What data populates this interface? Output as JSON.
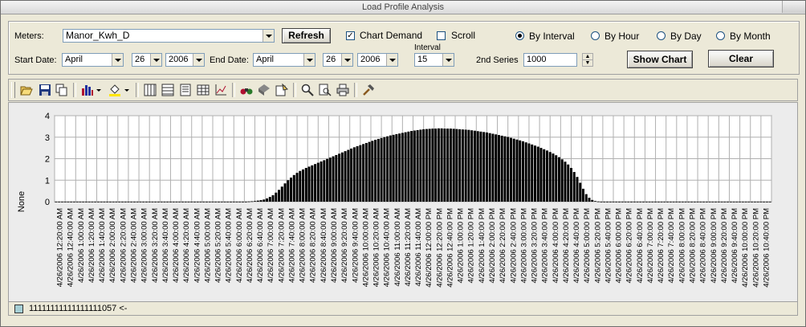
{
  "window": {
    "title": "Load Profile Analysis"
  },
  "controls": {
    "meters_label": "Meters:",
    "meter_value": "Manor_Kwh_D",
    "refresh_label": "Refresh",
    "chart_demand_label": "Chart Demand",
    "chart_demand_checked": true,
    "scroll_label": "Scroll",
    "scroll_checked": false,
    "radios": [
      {
        "label": "By Interval",
        "selected": true
      },
      {
        "label": "By Hour",
        "selected": false
      },
      {
        "label": "By Day",
        "selected": false
      },
      {
        "label": "By Month",
        "selected": false
      }
    ],
    "start_date_label": "Start Date:",
    "start_month": "April",
    "start_day": "26",
    "start_year": "2006",
    "end_date_label": "End Date:",
    "end_month": "April",
    "end_day": "26",
    "end_year": "2006",
    "interval_label": "Interval",
    "interval_value": "15",
    "second_series_label": "2nd Series",
    "second_series_value": "1000",
    "show_chart_label": "Show Chart",
    "clear_label": "Clear"
  },
  "toolbar": {
    "icons": [
      "open-folder-icon",
      "save-icon",
      "copy-icon",
      "bar-chart-icon",
      "chart-type-dropdown-icon",
      "fill-color-icon",
      "fill-color-dropdown-icon",
      "vertical-grid-icon",
      "horizontal-grid-icon",
      "legend-icon",
      "data-table-icon",
      "axis-icon",
      "binoculars-icon",
      "3d-icon",
      "palette-icon",
      "zoom-icon",
      "print-preview-icon",
      "print-icon",
      "tools-icon"
    ]
  },
  "chart_data": {
    "type": "bar",
    "ylabel": "None",
    "ylim": [
      0,
      4
    ],
    "yticks": [
      0,
      1,
      2,
      3,
      4
    ],
    "bar_color": "#000000",
    "x_labels": [
      "4/26/2006 12:20:00 AM",
      "4/26/2006 12:40:00 AM",
      "4/26/2006 1:00:00 AM",
      "4/26/2006 1:20:00 AM",
      "4/26/2006 1:40:00 AM",
      "4/26/2006 2:00:00 AM",
      "4/26/2006 2:20:00 AM",
      "4/26/2006 2:40:00 AM",
      "4/26/2006 3:00:00 AM",
      "4/26/2006 3:20:00 AM",
      "4/26/2006 3:40:00 AM",
      "4/26/2006 4:00:00 AM",
      "4/26/2006 4:20:00 AM",
      "4/26/2006 4:40:00 AM",
      "4/26/2006 5:00:00 AM",
      "4/26/2006 5:20:00 AM",
      "4/26/2006 5:40:00 AM",
      "4/26/2006 6:00:00 AM",
      "4/26/2006 6:20:00 AM",
      "4/26/2006 6:40:00 AM",
      "4/26/2006 7:00:00 AM",
      "4/26/2006 7:20:00 AM",
      "4/26/2006 7:40:00 AM",
      "4/26/2006 8:00:00 AM",
      "4/26/2006 8:20:00 AM",
      "4/26/2006 8:40:00 AM",
      "4/26/2006 9:00:00 AM",
      "4/26/2006 9:20:00 AM",
      "4/26/2006 9:40:00 AM",
      "4/26/2006 10:00:00 AM",
      "4/26/2006 10:20:00 AM",
      "4/26/2006 10:40:00 AM",
      "4/26/2006 11:00:00 AM",
      "4/26/2006 11:20:00 AM",
      "4/26/2006 11:40:00 AM",
      "4/26/2006 12:00:00 PM",
      "4/26/2006 12:20:00 PM",
      "4/26/2006 12:40:00 PM",
      "4/26/2006 1:00:00 PM",
      "4/26/2006 1:20:00 PM",
      "4/26/2006 1:40:00 PM",
      "4/26/2006 2:00:00 PM",
      "4/26/2006 2:20:00 PM",
      "4/26/2006 2:40:00 PM",
      "4/26/2006 3:00:00 PM",
      "4/26/2006 3:20:00 PM",
      "4/26/2006 3:40:00 PM",
      "4/26/2006 4:00:00 PM",
      "4/26/2006 4:20:00 PM",
      "4/26/2006 4:40:00 PM",
      "4/26/2006 5:00:00 PM",
      "4/26/2006 5:20:00 PM",
      "4/26/2006 5:40:00 PM",
      "4/26/2006 6:00:00 PM",
      "4/26/2006 6:20:00 PM",
      "4/26/2006 6:40:00 PM",
      "4/26/2006 7:00:00 PM",
      "4/26/2006 7:20:00 PM",
      "4/26/2006 7:40:00 PM",
      "4/26/2006 8:00:00 PM",
      "4/26/2006 8:20:00 PM",
      "4/26/2006 8:40:00 PM",
      "4/26/2006 9:00:00 PM",
      "4/26/2006 9:20:00 PM",
      "4/26/2006 9:40:00 PM",
      "4/26/2006 10:00:00 PM",
      "4/26/2006 10:20:00 PM",
      "4/26/2006 10:40:00 PM"
    ],
    "values": [
      0,
      0,
      0,
      0,
      0,
      0,
      0,
      0,
      0,
      0,
      0,
      0,
      0,
      0,
      0,
      0,
      0,
      0,
      0,
      0,
      0,
      0,
      0,
      0,
      0,
      0,
      0,
      0,
      0,
      0,
      0,
      0,
      0,
      0,
      0,
      0,
      0,
      0,
      0,
      0,
      0,
      0,
      0,
      0,
      0,
      0,
      0,
      0,
      0,
      0,
      0,
      0,
      0,
      0,
      0,
      0,
      0,
      0,
      0,
      0,
      0,
      0,
      0,
      0,
      0.01,
      0.02,
      0.03,
      0.05,
      0.07,
      0.1,
      0.15,
      0.22,
      0.3,
      0.42,
      0.55,
      0.7,
      0.85,
      1.0,
      1.12,
      1.24,
      1.34,
      1.43,
      1.5,
      1.57,
      1.63,
      1.69,
      1.75,
      1.81,
      1.87,
      1.93,
      1.99,
      2.05,
      2.11,
      2.17,
      2.23,
      2.29,
      2.35,
      2.41,
      2.47,
      2.53,
      2.58,
      2.63,
      2.68,
      2.73,
      2.78,
      2.83,
      2.88,
      2.92,
      2.96,
      3.0,
      3.04,
      3.08,
      3.11,
      3.14,
      3.17,
      3.2,
      3.23,
      3.26,
      3.29,
      3.31,
      3.33,
      3.35,
      3.37,
      3.38,
      3.39,
      3.4,
      3.4,
      3.41,
      3.41,
      3.4,
      3.4,
      3.4,
      3.39,
      3.38,
      3.37,
      3.36,
      3.35,
      3.34,
      3.32,
      3.3,
      3.28,
      3.26,
      3.24,
      3.22,
      3.19,
      3.16,
      3.13,
      3.1,
      3.07,
      3.04,
      3.01,
      2.97,
      2.93,
      2.89,
      2.85,
      2.81,
      2.76,
      2.71,
      2.66,
      2.61,
      2.56,
      2.5,
      2.44,
      2.38,
      2.31,
      2.24,
      2.16,
      2.07,
      1.97,
      1.86,
      1.73,
      1.57,
      1.38,
      1.15,
      0.88,
      0.6,
      0.35,
      0.18,
      0.08,
      0.03,
      0.01,
      0,
      0,
      0,
      0,
      0,
      0,
      0,
      0,
      0,
      0,
      0,
      0,
      0,
      0,
      0,
      0,
      0,
      0,
      0,
      0,
      0,
      0,
      0,
      0,
      0,
      0,
      0,
      0,
      0,
      0,
      0,
      0,
      0,
      0,
      0,
      0,
      0,
      0,
      0,
      0,
      0,
      0,
      0,
      0,
      0,
      0,
      0,
      0,
      0,
      0,
      0,
      0,
      0,
      0,
      0,
      0,
      0
    ]
  },
  "legend": {
    "series_name": "11111111111111111057 <-",
    "swatch_color": "#a6cfd5"
  }
}
